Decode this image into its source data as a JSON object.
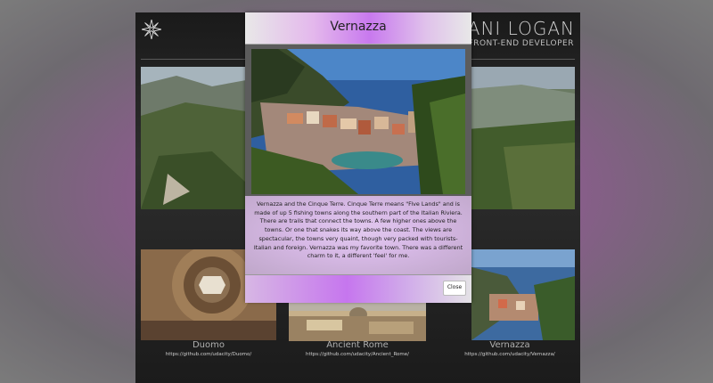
{
  "header": {
    "brand_name": "AZIANI LOGAN",
    "brand_title": "FRONT-END DEVELOPER",
    "logo_icon": "compass-star-icon"
  },
  "gallery": [
    {
      "caption": "Duomo",
      "link": "https://github.com/udacity/Duomo/"
    },
    {
      "caption": "Ancient Rome",
      "link": "https://github.com/udacity/Ancient_Rome/"
    },
    {
      "caption": "Vernazza",
      "link": "https://github.com/udacity/Vernazza/"
    }
  ],
  "modal": {
    "title": "Vernazza",
    "description": "Vernazza and the Cinque Terre. Cinque Terre means \"Five Lands\" and is made of up 5 fishing towns along the southern part of the Italian Riviera. There are trails that connect the towns. A few higher ones above the towns. Or one that snakes its way above the coast. The views are spectacular, the towns very quaint, though very packed with tourists- Italian and foreign. Vernazza was my favorite town. There was a different charm to it, a different 'feel' for me.",
    "close_label": "Close"
  },
  "colors": {
    "accent_purple": "#c879ee",
    "page_bg": "#1f1f1f"
  }
}
